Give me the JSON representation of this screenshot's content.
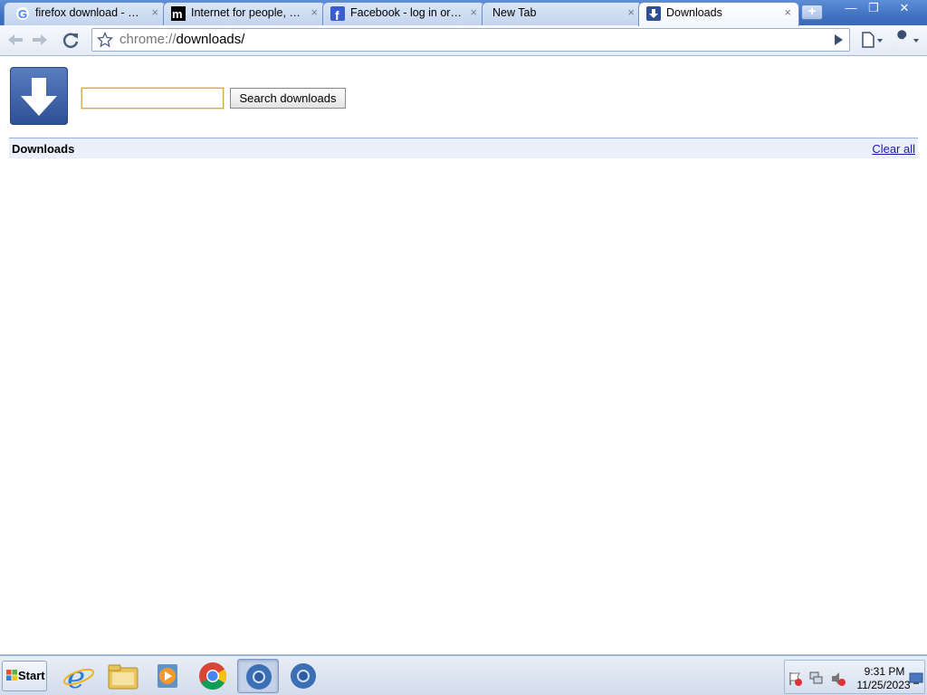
{
  "browser": {
    "tabs": [
      {
        "title": "firefox download - Go...",
        "icon": "google-icon"
      },
      {
        "title": "Internet for people, n...",
        "icon": "mozilla-icon"
      },
      {
        "title": "Facebook - log in or s...",
        "icon": "facebook-icon"
      },
      {
        "title": "New Tab",
        "icon": "none"
      },
      {
        "title": "Downloads",
        "icon": "download-icon"
      }
    ],
    "tab_close_glyph": "×",
    "new_tab_glyph": "+",
    "window_controls": {
      "minimize": "—",
      "restore": "❐",
      "close": "✕"
    },
    "url_scheme": "chrome://",
    "url_path": "downloads/"
  },
  "page": {
    "search_placeholder": "",
    "search_button": "Search downloads",
    "header_title": "Downloads",
    "clear_all": "Clear all"
  },
  "taskbar": {
    "start_label": "Start",
    "apps": [
      "internet-explorer",
      "file-explorer",
      "windows-media-player",
      "chrome",
      "chromium",
      "chromium"
    ],
    "time": "9:31 PM",
    "date": "11/25/2023"
  },
  "colors": {
    "titlebar": "#3d6fc2",
    "link": "#1a1aab",
    "header_bar": "#ebeff9"
  }
}
